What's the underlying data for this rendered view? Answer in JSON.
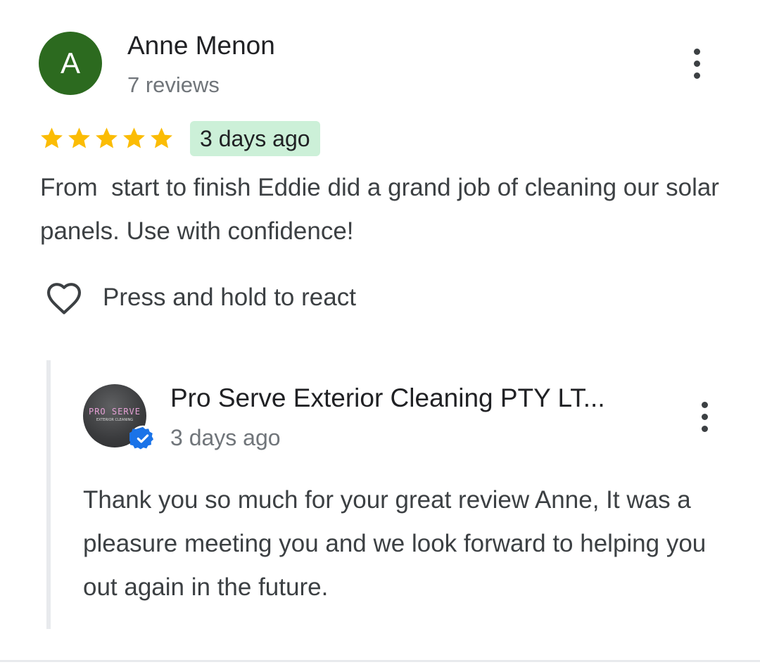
{
  "review": {
    "avatar_initial": "A",
    "avatar_color": "#2c6a1f",
    "reviewer_name": "Anne Menon",
    "reviewer_meta": "7 reviews",
    "rating": 5,
    "rating_max": 5,
    "star_color": "#fbbc04",
    "date": "3 days ago",
    "date_badge_color": "#ccf0d8",
    "text": "From  start to finish Eddie did a grand job of cleaning our solar panels. Use with confidence!",
    "react_label": "Press and hold to react",
    "more_icon": "more-vertical-icon"
  },
  "owner_reply": {
    "logo_text": "PRO SERVE",
    "logo_subtext": "EXTERIOR CLEANING",
    "owner_name": "Pro Serve Exterior Cleaning PTY LT...",
    "date": "3 days ago",
    "verified_icon": "verified-check-icon",
    "verified_color": "#1a73e8",
    "text": "Thank you so much for your great review Anne, It was a pleasure meeting you and we look forward to helping you out again in the future.",
    "more_icon": "more-vertical-icon"
  }
}
